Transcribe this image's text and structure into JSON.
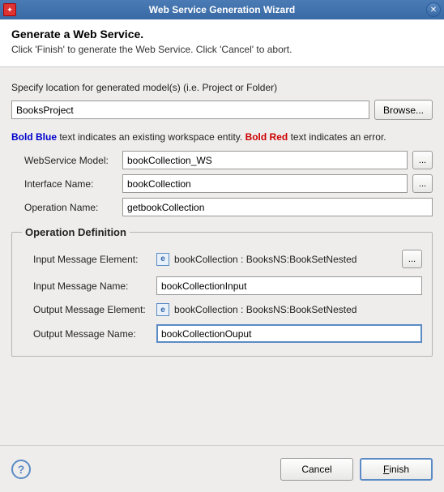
{
  "title": "Web Service Generation Wizard",
  "header": {
    "heading": "Generate a Web Service.",
    "instruction": "Click 'Finish' to generate the Web Service.  Click 'Cancel' to abort."
  },
  "location": {
    "label": "Specify location for generated model(s) (i.e. Project or Folder)",
    "value": "BooksProject",
    "browse": "Browse..."
  },
  "hint": {
    "blue": "Bold Blue",
    "mid": " text indicates an existing workspace entity.  ",
    "red": "Bold Red",
    "end": " text indicates an error."
  },
  "fields": {
    "ws_model_label": "WebService Model:",
    "ws_model_value": "bookCollection_WS",
    "iface_label": "Interface Name:",
    "iface_value": "bookCollection",
    "op_label": "Operation Name:",
    "op_value": "getbookCollection",
    "dots": "..."
  },
  "opdef": {
    "legend": "Operation Definition",
    "in_elem_label": "Input Message Element:",
    "in_elem_value": "bookCollection : BooksNS:BookSetNested",
    "in_name_label": "Input Message Name:",
    "in_name_value": "bookCollectionInput",
    "out_elem_label": "Output Message Element:",
    "out_elem_value": "bookCollection : BooksNS:BookSetNested",
    "out_name_label": "Output Message Name:",
    "out_name_value": "bookCollectionOuput",
    "e_glyph": "e",
    "dots": "..."
  },
  "footer": {
    "help": "?",
    "cancel": "Cancel",
    "finish_mnemonic": "F",
    "finish_rest": "inish"
  }
}
